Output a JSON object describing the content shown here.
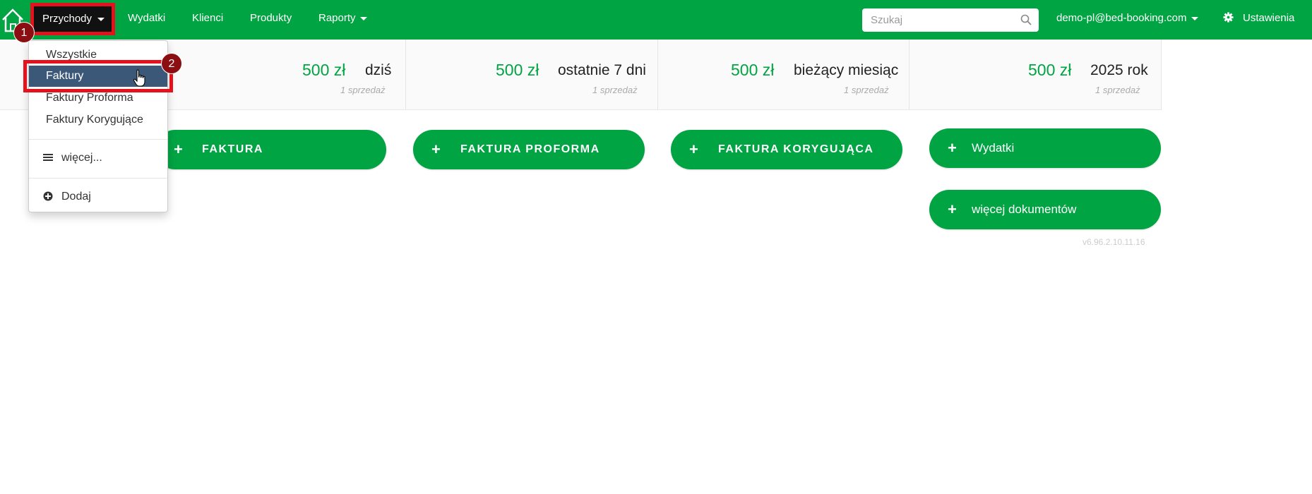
{
  "navbar": {
    "active_menu": "Przychody",
    "items": [
      "Wydatki",
      "Klienci",
      "Produkty",
      "Raporty"
    ],
    "search_placeholder": "Szukaj",
    "user_email": "demo-pl@bed-booking.com",
    "settings_label": "Ustawienia"
  },
  "stats": [
    {
      "amount": "500 zł",
      "period": "dziś",
      "sub": "1 sprzedaż"
    },
    {
      "amount": "500 zł",
      "period": "ostatnie 7 dni",
      "sub": "1 sprzedaż"
    },
    {
      "amount": "500 zł",
      "period": "bieżący miesiąc",
      "sub": "1 sprzedaż"
    },
    {
      "amount": "500 zł",
      "period": "2025 rok",
      "sub": "1 sprzedaż"
    }
  ],
  "actions": {
    "faktura": "FAKTURA",
    "proforma": "FAKTURA PROFORMA",
    "korygujaca": "FAKTURA KORYGUJĄCA",
    "wydatki": "Wydatki",
    "wiecej_dokumentow": "więcej dokumentów",
    "plus": "+"
  },
  "version": "v6.96.2.10.11.16",
  "dropdown": {
    "items": [
      "Wszystkie",
      "Faktury",
      "Faktury Proforma",
      "Faktury Korygujące"
    ],
    "more": "więcej...",
    "add": "Dodaj"
  },
  "annotations": {
    "step1": "1",
    "step2": "2"
  },
  "colors": {
    "brand_green": "#00a443",
    "highlight_red": "#e4121d",
    "active_item": "#3c5878",
    "badge": "#8b0e12"
  }
}
